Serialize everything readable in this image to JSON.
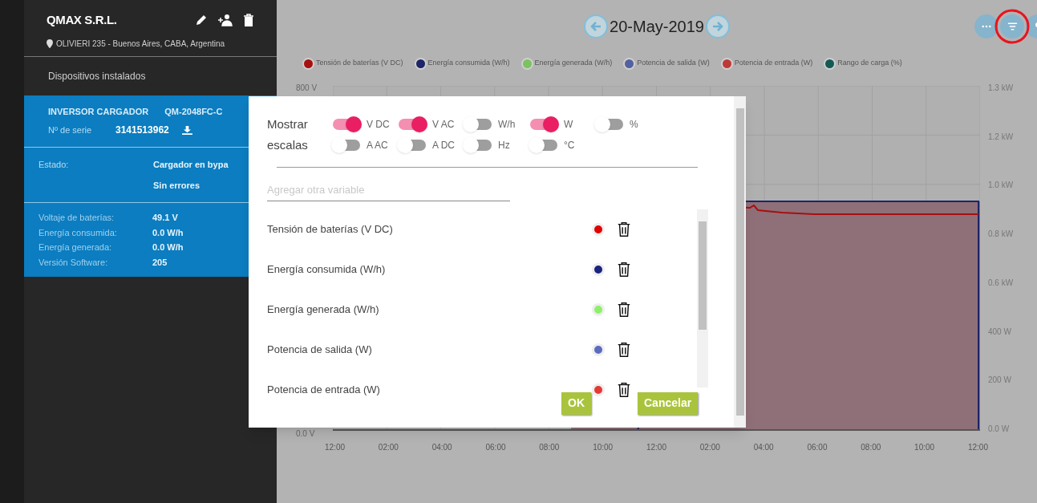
{
  "company": {
    "name": "QMAX S.R.L.",
    "address": "OLIVIERI 235 - Buenos Aires, CABA, Argentina"
  },
  "section_title": "Dispositivos instalados",
  "device": {
    "type": "INVERSOR CARGADOR",
    "model": "QM-2048FC-C",
    "serial_label": "Nº de serie",
    "serial": "3141513962",
    "status_label": "Estado:",
    "status": [
      "Cargador en bypa",
      "Sin errores"
    ],
    "readings": [
      {
        "label": "Voltaje de baterías:",
        "value": "49.1 V"
      },
      {
        "label": "Energía consumida:",
        "value": "0.0 W/h"
      },
      {
        "label": "Energía generada:",
        "value": "0.0 W/h"
      },
      {
        "label": "Versión Software:",
        "value": "205"
      }
    ]
  },
  "date": "20-May-2019",
  "legend": [
    {
      "label": "Tensión de baterías (V DC)",
      "color": "#a80f0f"
    },
    {
      "label": "Energía consumida (W/h)",
      "color": "#1d2468"
    },
    {
      "label": "Energía generada (W/h)",
      "color": "#7ac35f"
    },
    {
      "label": "Potencia de salida (W)",
      "color": "#5560a0"
    },
    {
      "label": "Potencia de entrada (W)",
      "color": "#bd3a37"
    },
    {
      "label": "Rango de carga (%)",
      "color": "#145a54"
    }
  ],
  "chart": {
    "left_ticks": [
      "800 V",
      "0.0 V"
    ],
    "right_ticks": [
      "1.3 kW",
      "1.2 kW",
      "1.0 kW",
      "0.8 kW",
      "0.6 kW",
      "400 W",
      "200 W",
      "0.0 W"
    ],
    "x_ticks": [
      "12:00",
      "02:00",
      "04:00",
      "06:00",
      "08:00",
      "10:00",
      "12:00",
      "02:00",
      "04:00",
      "06:00",
      "08:00",
      "10:00",
      "12:00"
    ]
  },
  "dialog": {
    "scales_label": "Mostrar escalas",
    "toggles": [
      [
        {
          "label": "V DC",
          "on": true
        },
        {
          "label": "V AC",
          "on": true
        },
        {
          "label": "W/h",
          "on": false
        },
        {
          "label": "W",
          "on": true
        },
        {
          "label": "%",
          "on": false
        }
      ],
      [
        {
          "label": "A AC",
          "on": false
        },
        {
          "label": "A DC",
          "on": false
        },
        {
          "label": "Hz",
          "on": false
        },
        {
          "label": "°C",
          "on": false
        }
      ]
    ],
    "add_placeholder": "Agregar otra variable",
    "variables": [
      {
        "name": "Tensión de baterías (V DC)",
        "color": "#e00000"
      },
      {
        "name": "Energía consumida (W/h)",
        "color": "#1a237e"
      },
      {
        "name": "Energía generada (W/h)",
        "color": "#8ef06a"
      },
      {
        "name": "Potencia de salida (W)",
        "color": "#5c6bc0"
      },
      {
        "name": "Potencia de entrada (W)",
        "color": "#e53935"
      }
    ],
    "buttons": [
      "OK",
      "Cancelar"
    ]
  }
}
